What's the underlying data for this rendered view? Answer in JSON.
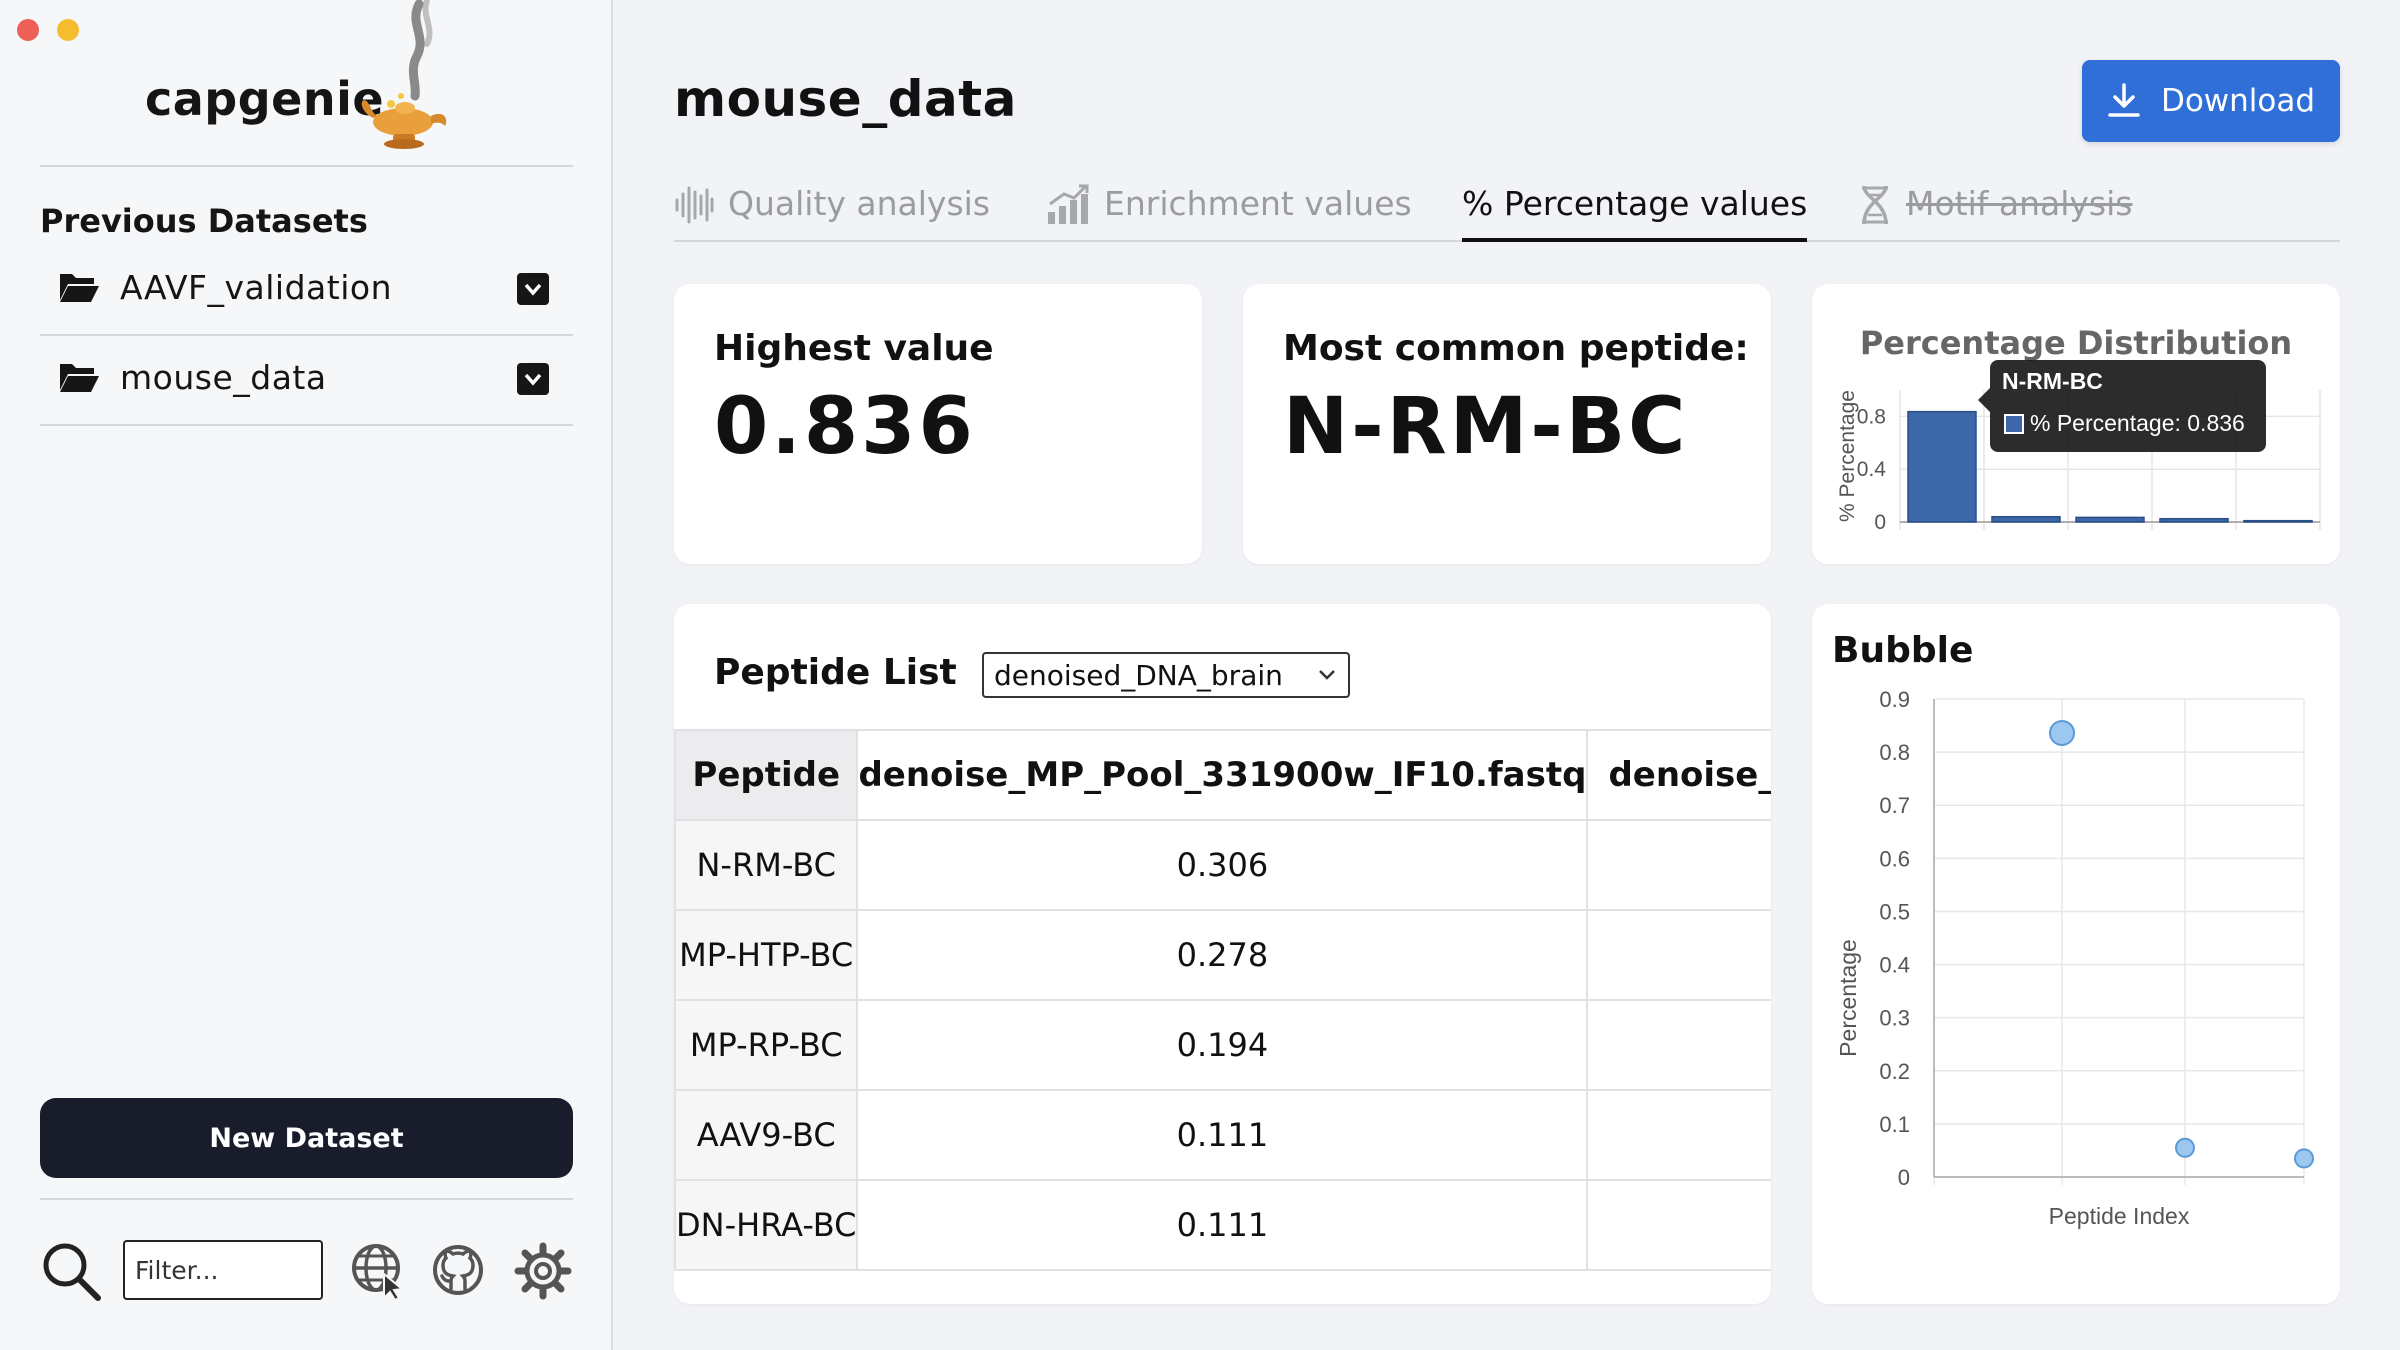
{
  "app": {
    "brand_name": "capgenie"
  },
  "sidebar": {
    "previous_title": "Previous Datasets",
    "datasets": [
      {
        "label": "AAVF_validation"
      },
      {
        "label": "mouse_data"
      }
    ],
    "new_dataset_label": "New Dataset",
    "filter_placeholder": "Filter..."
  },
  "header": {
    "dataset_title": "mouse_data",
    "download_label": "Download"
  },
  "tabs": [
    {
      "label": "Quality analysis",
      "icon": "waveform-icon",
      "state": "inactive"
    },
    {
      "label": "Enrichment values",
      "icon": "bar-chart-icon",
      "state": "inactive"
    },
    {
      "label": "% Percentage values",
      "icon": "",
      "state": "active"
    },
    {
      "label": "Motif analysis",
      "icon": "dna-icon",
      "state": "disabled"
    }
  ],
  "stats": {
    "highest_label": "Highest value",
    "highest_value": "0.836",
    "common_label": "Most common peptide:",
    "common_value": "N-RM-BC"
  },
  "peptide_list": {
    "title": "Peptide List",
    "selected_sample": "denoised_DNA_brain",
    "columns": [
      "Peptide",
      "denoise_MP_Pool_331900w_IF10.fastq",
      "denoise_"
    ],
    "rows": [
      {
        "peptide": "N-RM-BC",
        "v1": "0.306",
        "v2": ""
      },
      {
        "peptide": "MP-HTP-BC",
        "v1": "0.278",
        "v2": ""
      },
      {
        "peptide": "MP-RP-BC",
        "v1": "0.194",
        "v2": ""
      },
      {
        "peptide": "AAV9-BC",
        "v1": "0.111",
        "v2": ""
      },
      {
        "peptide": "DN-HRA-BC",
        "v1": "0.111",
        "v2": ""
      }
    ]
  },
  "chart_data": [
    {
      "type": "bar",
      "title": "Percentage Distribution",
      "ylabel": "% Percentage",
      "xlabel": "",
      "ylim": [
        0,
        1
      ],
      "yticks": [
        "0",
        "0.4",
        "0.8"
      ],
      "categories": [
        "N-RM-BC",
        "",
        "",
        "",
        ""
      ],
      "values": [
        0.836,
        0.04,
        0.035,
        0.025,
        0.01
      ],
      "bar_color": "#3c67a8",
      "tooltip": {
        "title": "N-RM-BC",
        "text": "% Percentage: 0.836"
      }
    },
    {
      "type": "scatter",
      "title": "Bubble",
      "xlabel": "Peptide Index",
      "ylabel": "Percentage",
      "ylim": [
        0,
        0.9
      ],
      "yticks": [
        "0",
        "0.1",
        "0.2",
        "0.3",
        "0.4",
        "0.5",
        "0.6",
        "0.7",
        "0.8",
        "0.9"
      ],
      "points": [
        {
          "x": 1,
          "y": 0.836
        },
        {
          "x": 2,
          "y": 0.055
        },
        {
          "x": 3,
          "y": 0.035
        }
      ],
      "point_color": "#9cc8f0"
    }
  ],
  "colors": {
    "accent": "#2f6fd7",
    "dark_button": "#181c2b"
  }
}
